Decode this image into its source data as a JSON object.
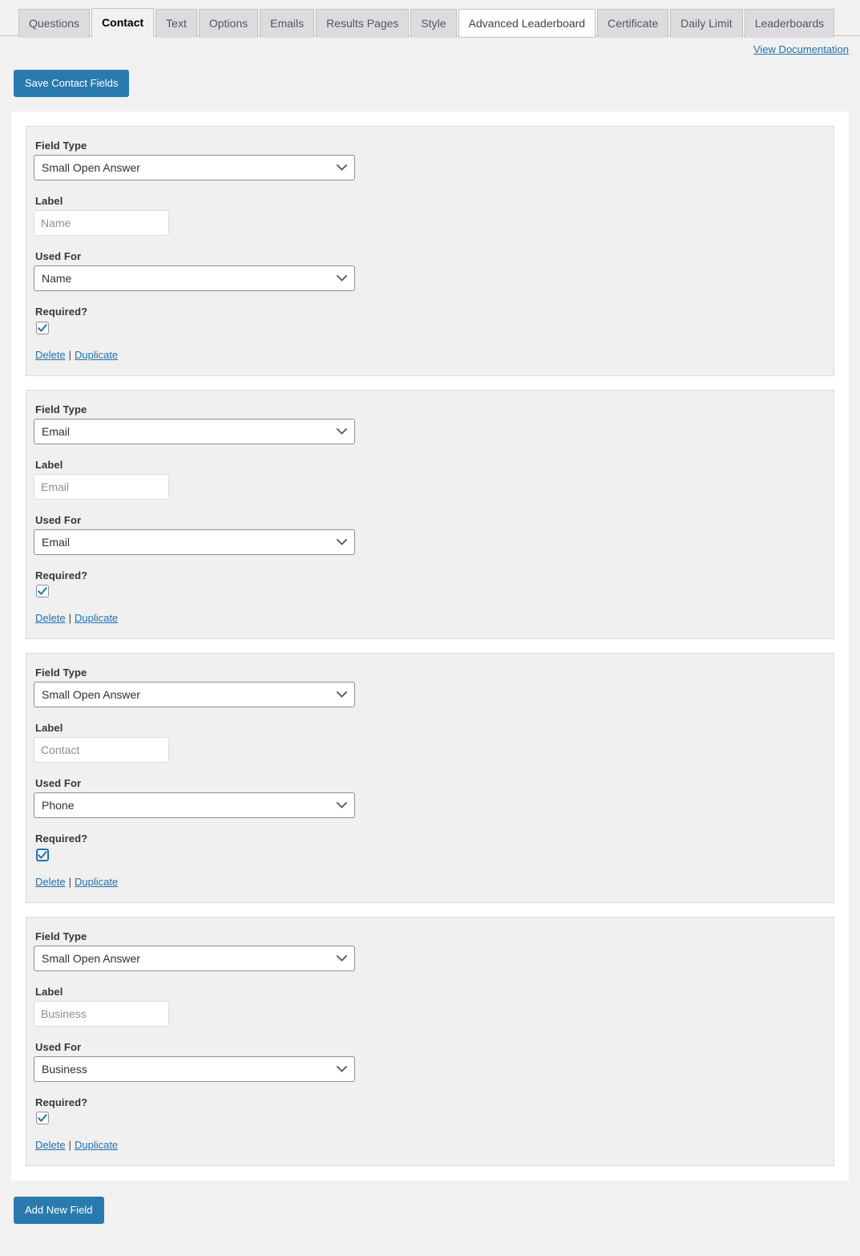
{
  "tabs": [
    {
      "label": "Questions",
      "state": "default"
    },
    {
      "label": "Contact",
      "state": "active"
    },
    {
      "label": "Text",
      "state": "default"
    },
    {
      "label": "Options",
      "state": "default"
    },
    {
      "label": "Emails",
      "state": "default"
    },
    {
      "label": "Results Pages",
      "state": "default"
    },
    {
      "label": "Style",
      "state": "default"
    },
    {
      "label": "Advanced Leaderboard",
      "state": "hover"
    },
    {
      "label": "Certificate",
      "state": "default"
    },
    {
      "label": "Daily Limit",
      "state": "default"
    },
    {
      "label": "Leaderboards",
      "state": "default"
    }
  ],
  "header": {
    "documentation_link": "View Documentation",
    "save_button": "Save Contact Fields"
  },
  "labels": {
    "field_type": "Field Type",
    "label": "Label",
    "used_for": "Used For",
    "required": "Required?",
    "delete": "Delete",
    "duplicate": "Duplicate",
    "separator": "|"
  },
  "fields": [
    {
      "field_type": "Small Open Answer",
      "label_placeholder": "Name",
      "label_value": "",
      "used_for": "Name",
      "required": true,
      "checkbox_focused": false
    },
    {
      "field_type": "Email",
      "label_placeholder": "Email",
      "label_value": "",
      "used_for": "Email",
      "required": true,
      "checkbox_focused": false
    },
    {
      "field_type": "Small Open Answer",
      "label_placeholder": "Contact",
      "label_value": "",
      "used_for": "Phone",
      "required": true,
      "checkbox_focused": true
    },
    {
      "field_type": "Small Open Answer",
      "label_placeholder": "Business",
      "label_value": "",
      "used_for": "Business",
      "required": true,
      "checkbox_focused": false
    }
  ],
  "footer": {
    "add_button": "Add New Field"
  },
  "colors": {
    "accent": "#2a7ab0",
    "link": "#2271b1",
    "page_bg": "#f1f1f1",
    "panel_bg": "#f0f0f0",
    "panel_border": "#e0d9dd",
    "tab_bg": "#dcdcde",
    "tab_border": "#c3c4c7"
  },
  "icons": {
    "chevron": "chevron-down-icon",
    "check": "check-icon"
  }
}
